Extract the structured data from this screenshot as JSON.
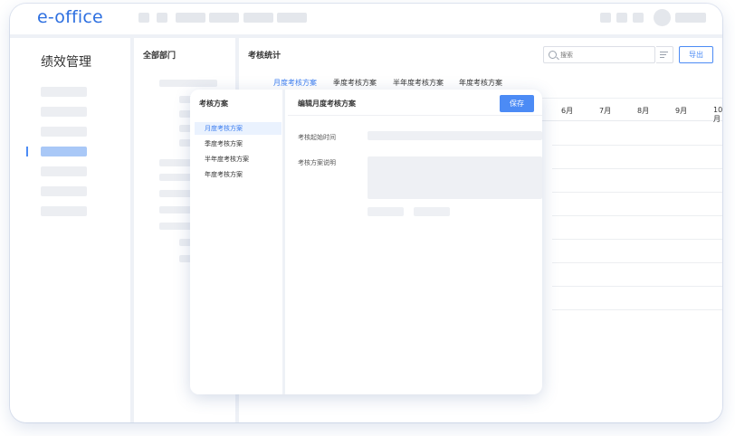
{
  "app": {
    "logo": "e-office"
  },
  "left_nav": {
    "module_title": "绩效管理"
  },
  "dept_panel": {
    "title": "全部部门"
  },
  "main": {
    "title": "考核统计",
    "search": {
      "placeholder": "搜索",
      "value": ""
    },
    "export_label": "导出",
    "tabs": [
      {
        "label": "月度考核方案",
        "active": true
      },
      {
        "label": "季度考核方案",
        "active": false
      },
      {
        "label": "半年度考核方案",
        "active": false
      },
      {
        "label": "年度考核方案",
        "active": false
      }
    ],
    "months": [
      "6月",
      "7月",
      "8月",
      "9月",
      "10月"
    ]
  },
  "modal": {
    "left_title": "考核方案",
    "items": [
      {
        "label": "月度考核方案",
        "active": true
      },
      {
        "label": "季度考核方案",
        "active": false
      },
      {
        "label": "半年度考核方案",
        "active": false
      },
      {
        "label": "年度考核方案",
        "active": false
      }
    ],
    "right_title": "编辑月度考核方案",
    "save_label": "保存",
    "fields": [
      {
        "label": "考核起始时间"
      },
      {
        "label": "考核方案说明"
      }
    ]
  },
  "colors": {
    "accent": "#4c8bf5",
    "logo": "#2d6fe0",
    "active_tab": "#3a7cf0"
  }
}
